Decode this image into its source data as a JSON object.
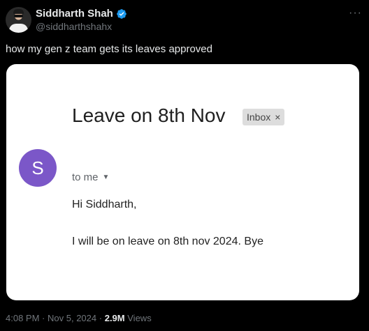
{
  "author": {
    "display_name": "Siddharth Shah",
    "handle": "@siddharthshahx",
    "verified_icon": "verified-badge-icon",
    "badge_color": "#1d9bf0"
  },
  "more_icon": "···",
  "tweet": {
    "text": "how my gen z team gets its leaves approved"
  },
  "email": {
    "subject": "Leave on 8th Nov",
    "label": "Inbox",
    "label_close": "×",
    "sender_initial": "S",
    "sender_color": "#7b57c8",
    "recipient": "to me",
    "greeting": "Hi Siddharth,",
    "body": "I will be on leave on 8th nov 2024. Bye"
  },
  "meta": {
    "time": "4:08 PM",
    "date": "Nov 5, 2024",
    "views_count": "2.9M",
    "views_label": "Views",
    "separator": "·"
  }
}
